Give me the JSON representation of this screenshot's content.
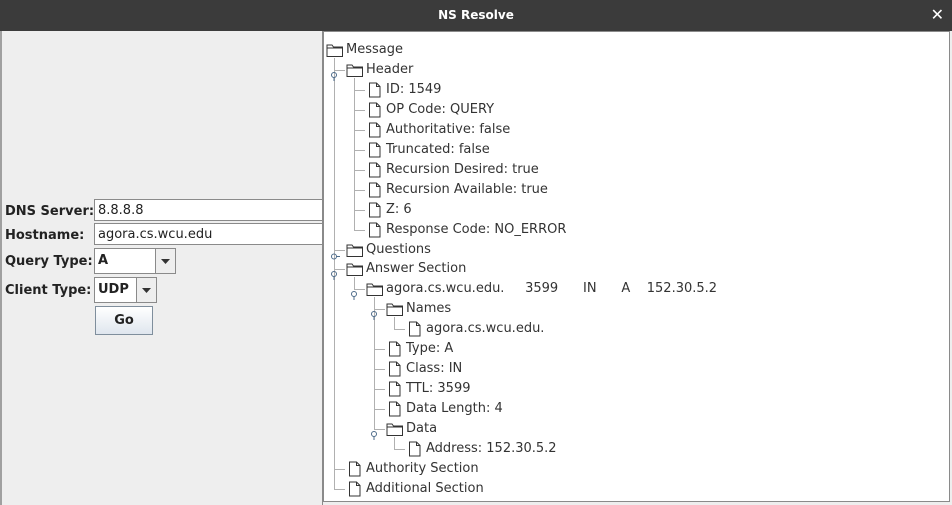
{
  "window": {
    "title": "NS Resolve",
    "close_glyph": "✕"
  },
  "form": {
    "dns_server_label": "DNS Server:",
    "dns_server_value": "8.8.8.8",
    "hostname_label": "Hostname:",
    "hostname_value": "agora.cs.wcu.edu",
    "query_type_label": "Query Type:",
    "query_type_value": "A",
    "client_type_label": "Client Type:",
    "client_type_value": "UDP",
    "go_label": "Go"
  },
  "tree": {
    "root": "Message",
    "header": "Header",
    "id": "ID: 1549",
    "op_code": "OP Code: QUERY",
    "authoritative": "Authoritative: false",
    "truncated": "Truncated: false",
    "recursion_desired": "Recursion Desired: true",
    "recursion_available": "Recursion Available: true",
    "z": "Z: 6",
    "response_code": "Response Code: NO_ERROR",
    "questions": "Questions",
    "answer_section": "Answer Section",
    "answer_record": "agora.cs.wcu.edu.     3599      IN      A    152.30.5.2",
    "names": "Names",
    "name_value": "agora.cs.wcu.edu.",
    "type": "Type: A",
    "class": "Class: IN",
    "ttl": "TTL: 3599",
    "data_length": "Data Length: 4",
    "data": "Data",
    "address": "Address: 152.30.5.2",
    "authority_section": "Authority Section",
    "additional_section": "Additional Section"
  }
}
